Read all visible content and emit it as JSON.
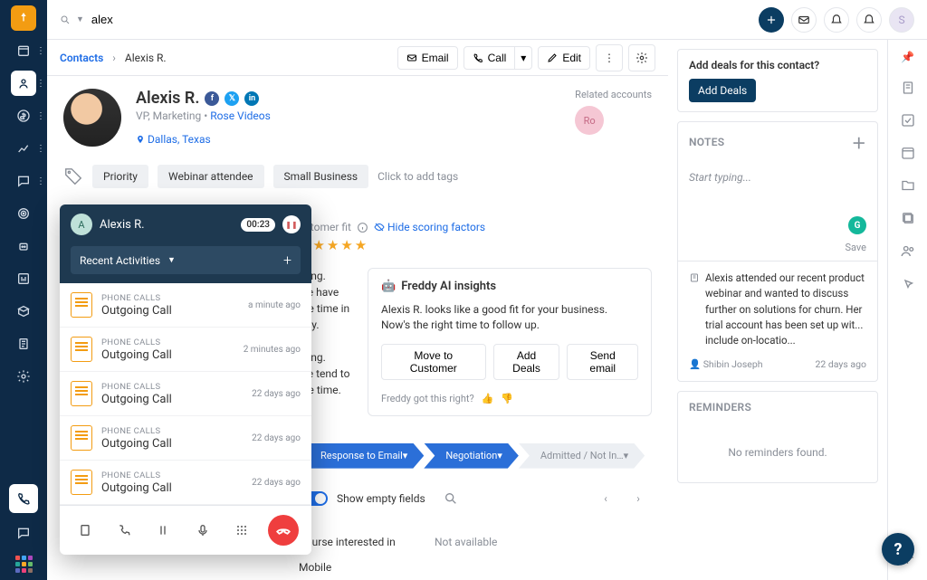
{
  "search": {
    "value": "alex"
  },
  "top_avatar": "S",
  "breadcrumb": {
    "root": "Contacts",
    "name": "Alexis R."
  },
  "header_actions": {
    "email": "Email",
    "call": "Call",
    "edit": "Edit"
  },
  "contact": {
    "name": "Alexis R.",
    "title": "VP, Marketing",
    "company": "Rose Videos",
    "location": "Dallas, Texas",
    "related_label": "Related accounts",
    "related_badge": "Ro"
  },
  "tags": [
    "Priority",
    "Webinar attendee",
    "Small Business"
  ],
  "tags_placeholder": "Click to add tags",
  "score": {
    "fit_label": "ustomer fit",
    "hide": "Hide scoring factors",
    "stars": "★★★★★"
  },
  "desc_lines": [
    "eting.",
    "itle have",
    "the time in",
    "stry.",
    "",
    "eting.",
    "itle tend to",
    "the time."
  ],
  "freddy": {
    "title": "Freddy AI insights",
    "body": "Alexis R. looks like a good fit for your business. Now's the right time to follow up.",
    "actions": [
      "Move to Customer",
      "Add Deals",
      "Send email"
    ],
    "footer": "Freddy got this right?"
  },
  "stages": [
    "Response to Email",
    "Negotiation",
    "Admitted / Not In…"
  ],
  "show_empty": "Show empty fields",
  "details": {
    "course_label": "Course interested in",
    "course_value": "Not available",
    "mobile_label": "Mobile"
  },
  "rightside": {
    "add_deals_q": "Add deals for this contact?",
    "add_deals_btn": "Add Deals",
    "notes_title": "NOTES",
    "notes_placeholder": "Start typing...",
    "save": "Save",
    "note_body": "Alexis attended our recent product webinar and wanted to discuss further on solutions for churn. Her trial account has been set up wit... include on-locatio...",
    "note_author": "Shibin Joseph",
    "note_time": "22 days ago",
    "reminders_title": "REMINDERS",
    "reminders_empty": "No reminders found."
  },
  "call": {
    "name": "Alexis R.",
    "avatar": "A",
    "timer": "00:23",
    "recent": "Recent Activities",
    "items": [
      {
        "cat": "PHONE CALLS",
        "title": "Outgoing Call",
        "time": "a minute ago"
      },
      {
        "cat": "PHONE CALLS",
        "title": "Outgoing Call",
        "time": "2 minutes ago"
      },
      {
        "cat": "PHONE CALLS",
        "title": "Outgoing Call",
        "time": "22 days ago"
      },
      {
        "cat": "PHONE CALLS",
        "title": "Outgoing Call",
        "time": "22 days ago"
      },
      {
        "cat": "PHONE CALLS",
        "title": "Outgoing Call",
        "time": "22 days ago"
      }
    ]
  }
}
